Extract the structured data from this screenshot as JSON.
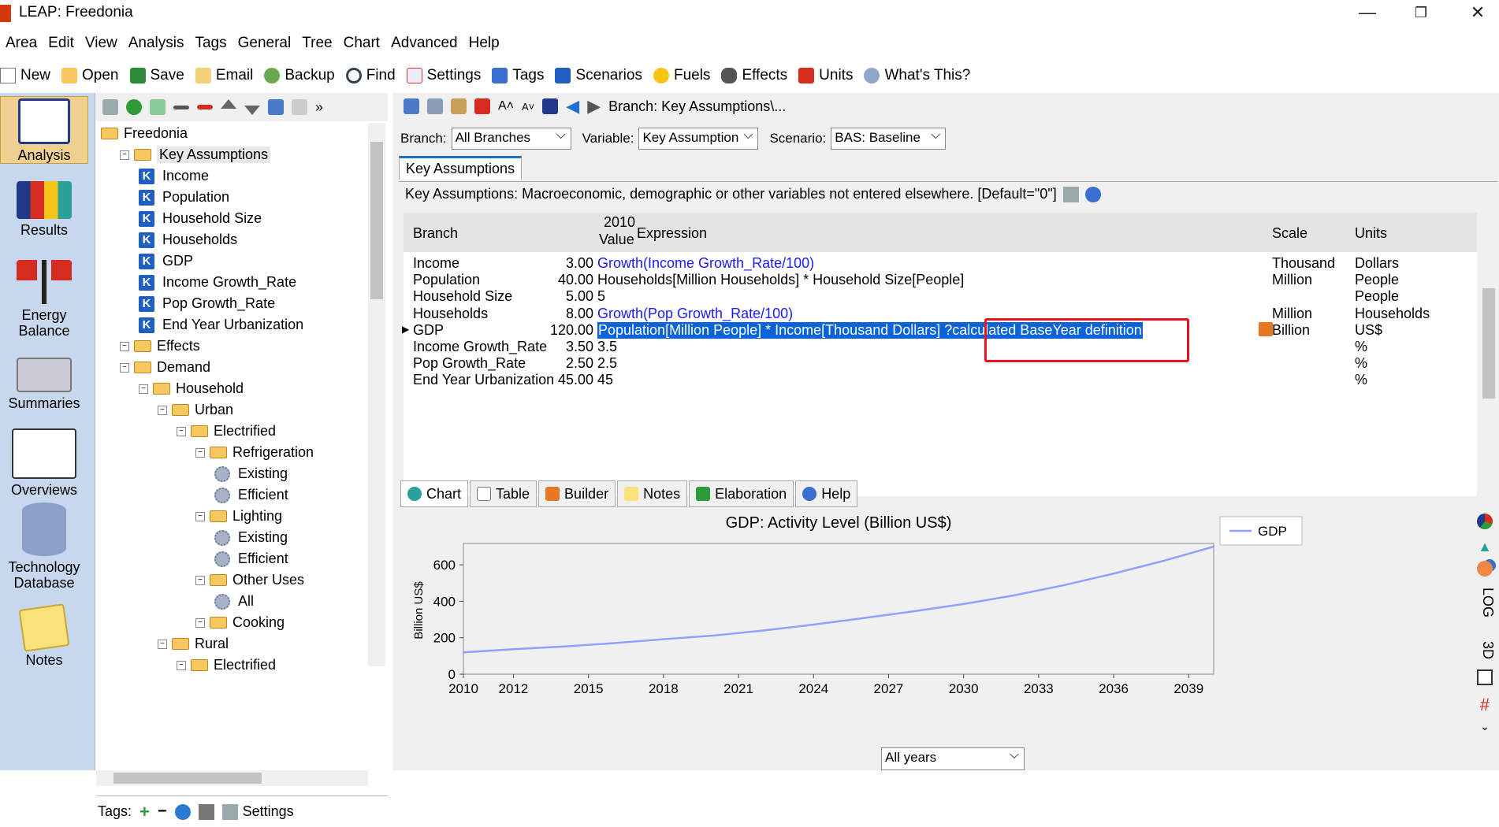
{
  "window": {
    "title": "LEAP: Freedonia",
    "minimize": "—",
    "restore": "❐",
    "close": "✕"
  },
  "menu": [
    "Area",
    "Edit",
    "View",
    "Analysis",
    "Tags",
    "General",
    "Tree",
    "Chart",
    "Advanced",
    "Help"
  ],
  "toolbar": [
    "New",
    "Open",
    "Save",
    "Email",
    "Backup",
    "Find",
    "Settings",
    "Tags",
    "Scenarios",
    "Fuels",
    "Effects",
    "Units",
    "What's This?"
  ],
  "sidebar": [
    "Analysis",
    "Results",
    "Energy Balance",
    "Summaries",
    "Overviews",
    "Technology Database",
    "Notes"
  ],
  "tree": [
    {
      "label": "Freedonia",
      "type": "folder",
      "level": 0
    },
    {
      "label": "Key Assumptions",
      "type": "folder",
      "level": 1
    },
    {
      "label": "Income",
      "type": "key",
      "level": 2
    },
    {
      "label": "Population",
      "type": "key",
      "level": 2
    },
    {
      "label": "Household Size",
      "type": "key",
      "level": 2
    },
    {
      "label": "Households",
      "type": "key",
      "level": 2
    },
    {
      "label": "GDP",
      "type": "key",
      "level": 2
    },
    {
      "label": "Income Growth_Rate",
      "type": "key",
      "level": 2
    },
    {
      "label": "Pop Growth_Rate",
      "type": "key",
      "level": 2
    },
    {
      "label": "End Year Urbanization",
      "type": "key",
      "level": 2
    },
    {
      "label": "Effects",
      "type": "folder",
      "level": 1
    },
    {
      "label": "Demand",
      "type": "folder",
      "level": 1
    },
    {
      "label": "Household",
      "type": "folder",
      "level": 2
    },
    {
      "label": "Urban",
      "type": "folder",
      "level": 3
    },
    {
      "label": "Electrified",
      "type": "folder",
      "level": 4
    },
    {
      "label": "Refrigeration",
      "type": "folder",
      "level": 5
    },
    {
      "label": "Existing",
      "type": "gear",
      "level": 6
    },
    {
      "label": "Efficient",
      "type": "gear",
      "level": 6
    },
    {
      "label": "Lighting",
      "type": "folder",
      "level": 5
    },
    {
      "label": "Existing",
      "type": "gear",
      "level": 6
    },
    {
      "label": "Efficient",
      "type": "gear",
      "level": 6
    },
    {
      "label": "Other Uses",
      "type": "folder",
      "level": 5
    },
    {
      "label": "All",
      "type": "gear",
      "level": 6
    },
    {
      "label": "Cooking",
      "type": "folder",
      "level": 5
    },
    {
      "label": "Rural",
      "type": "folder",
      "level": 3
    },
    {
      "label": "Electrified",
      "type": "folder",
      "level": 4
    }
  ],
  "tags_bar": {
    "label": "Tags:",
    "settings": "Settings"
  },
  "main": {
    "breadcrumb": "Branch: Key Assumptions\\...",
    "branch_label": "Branch:",
    "branch_value": "All Branches",
    "variable_label": "Variable:",
    "variable_value": "Key Assumption",
    "scenario_label": "Scenario:",
    "scenario_value": "BAS: Baseline",
    "tab": "Key Assumptions",
    "description": "Key Assumptions: Macroeconomic, demographic or other variables not entered elsewhere. [Default=\"0\"]"
  },
  "grid": {
    "headers": {
      "branch": "Branch",
      "year": "2010",
      "value": "Value",
      "expression": "Expression",
      "scale": "Scale",
      "units": "Units"
    },
    "rows": [
      {
        "branch": "Income",
        "value": "3.00",
        "expr": "Growth(Income Growth_Rate/100)",
        "scale": "Thousand",
        "units": "Dollars",
        "blue": true
      },
      {
        "branch": "Population",
        "value": "40.00",
        "expr": "Households[Million Households] * Household Size[People]",
        "scale": "Million",
        "units": "People",
        "blue": false
      },
      {
        "branch": "Household Size",
        "value": "5.00",
        "expr": "5",
        "scale": "",
        "units": "People",
        "blue": false
      },
      {
        "branch": "Households",
        "value": "8.00",
        "expr": "Growth(Pop Growth_Rate/100)",
        "scale": "Million",
        "units": "Households",
        "blue": true
      },
      {
        "branch": "GDP",
        "value": "120.00",
        "expr": "Population[Million People] * Income[Thousand Dollars] ?calculated BaseYear definition",
        "scale": "Billion",
        "units": "US$",
        "blue": false
      },
      {
        "branch": "Income Growth_Rate",
        "value": "3.50",
        "expr": "3.5",
        "scale": "",
        "units": "%",
        "blue": false
      },
      {
        "branch": "Pop Growth_Rate",
        "value": "2.50",
        "expr": "2.5",
        "scale": "",
        "units": "%",
        "blue": false
      },
      {
        "branch": "End Year Urbanization",
        "value": "45.00",
        "expr": "45",
        "scale": "",
        "units": "%",
        "blue": false
      }
    ]
  },
  "bottom_tabs": [
    "Chart",
    "Table",
    "Builder",
    "Notes",
    "Elaboration",
    "Help"
  ],
  "chart_data": {
    "type": "line",
    "title": "GDP: Activity Level (Billion US$)",
    "ylabel": "Billion US$",
    "xlabel": "",
    "xlim": [
      2010,
      2040
    ],
    "ylim": [
      0,
      700
    ],
    "x_ticks": [
      2010,
      2012,
      2015,
      2018,
      2021,
      2024,
      2027,
      2030,
      2033,
      2036,
      2039
    ],
    "y_ticks": [
      0,
      200,
      400,
      600
    ],
    "legend": "top-right",
    "series": [
      {
        "name": "GDP",
        "color": "#8fa0ff",
        "x": [
          2010,
          2012,
          2014,
          2016,
          2018,
          2020,
          2022,
          2024,
          2026,
          2028,
          2030,
          2032,
          2034,
          2036,
          2038,
          2040
        ],
        "values": [
          120,
          137,
          152,
          170,
          192,
          212,
          240,
          272,
          308,
          345,
          385,
          432,
          488,
          552,
          622,
          700
        ]
      }
    ]
  },
  "year_select": "All years",
  "right_tools": [
    "LOG",
    "3D"
  ]
}
